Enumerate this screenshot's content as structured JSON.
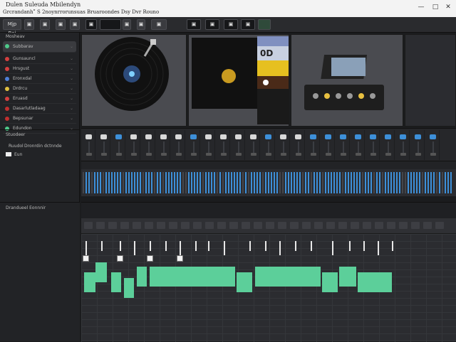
{
  "window": {
    "title": "Dulen Suleuda Mbilendyn",
    "subtitle": "Grcrandanhʺ S 2noynrrorunsuas Bruaroondes Dsy Dvr Rouno",
    "controls": {
      "minimize": "—",
      "maximize": "□",
      "close": "✕"
    }
  },
  "toolbar": {
    "project_label": "Mjp Bai",
    "buttons": [
      "▣",
      "▣",
      "▣",
      "▣",
      "▣",
      "▣",
      "▣",
      "▣",
      "▣",
      "▣",
      "▣",
      "▣"
    ]
  },
  "sidebar": {
    "header": "Mosheav",
    "items": [
      {
        "label": "Subbarav",
        "color": "#4fc98a",
        "selected": true
      },
      {
        "label": "Gunsauncl",
        "color": "#d44040"
      },
      {
        "label": "Hrsgust",
        "color": "#d44040"
      },
      {
        "label": "Eronxdal",
        "color": "#4f80d8"
      },
      {
        "label": "Drdrcu",
        "color": "#e0c040"
      },
      {
        "label": "Eruasd",
        "color": "#d44040"
      },
      {
        "label": "Dasarlutladaag",
        "color": "#c03030"
      },
      {
        "label": "Bepsunar",
        "color": "#c03030"
      },
      {
        "label": "Edundon",
        "color": "#4fc98a"
      }
    ],
    "section2_title": "Stuodeer",
    "section2_row": "Ruudol",
    "section2_row_b": "Dronrdin dctnnde",
    "section2_item": "Eun",
    "section3_title": "Drandueel Eonnnir"
  },
  "thumbs": [
    {
      "name": "Vinyl Record"
    },
    {
      "name": "Album Art"
    },
    {
      "name": "Synth Hardware"
    }
  ],
  "album_art": {
    "text": "0D"
  },
  "colors": {
    "accent_teal": "#5ccf9a",
    "accent_blue": "#3d8fd8",
    "bg": "#1b1c1e"
  }
}
